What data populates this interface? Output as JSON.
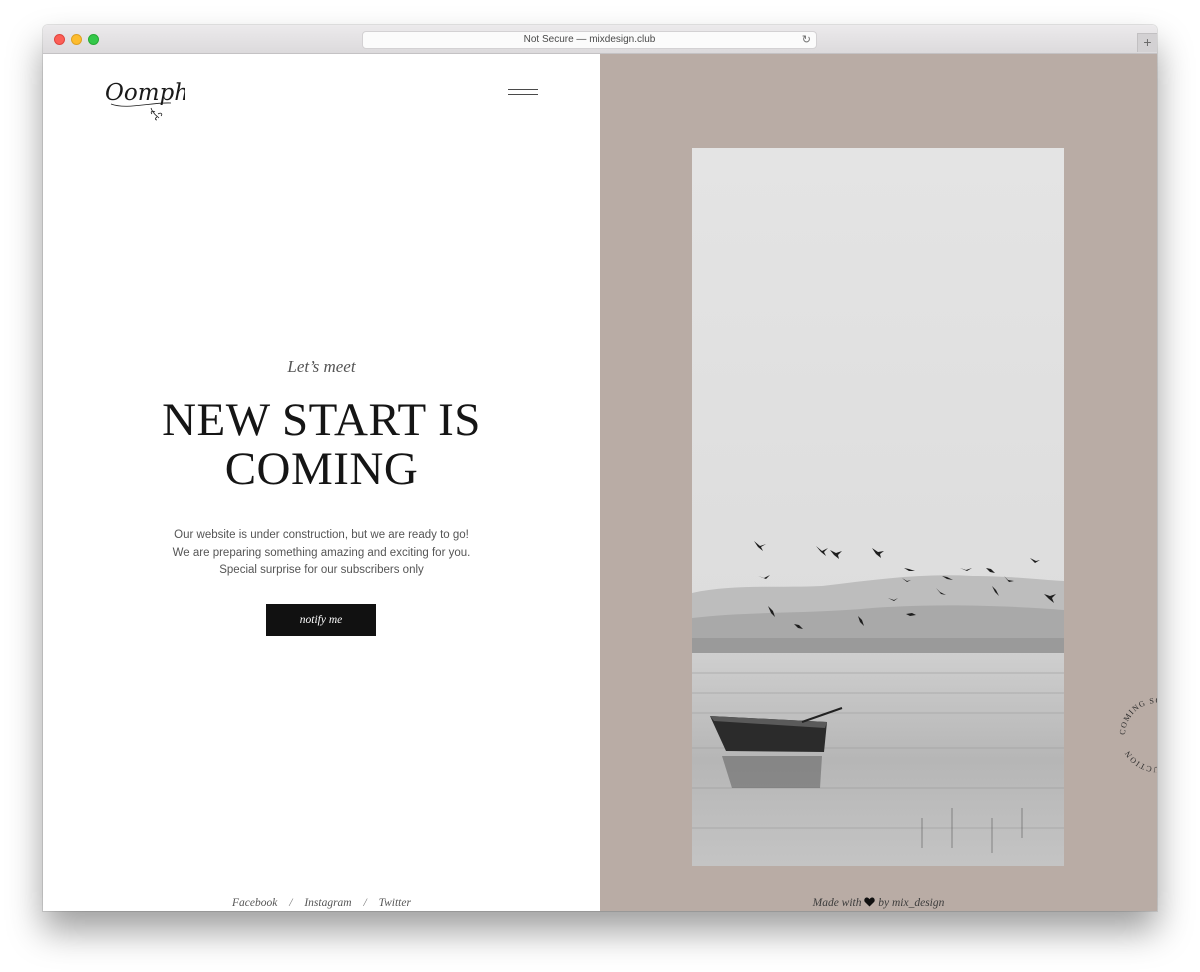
{
  "browser": {
    "url_text": "Not Secure — mixdesign.club",
    "new_tab_label": "+",
    "reload_label": "↻"
  },
  "brand": {
    "logo_text": "Oomph"
  },
  "hero": {
    "eyebrow": "Let’s meet",
    "headline_line1": "NEW START IS",
    "headline_line2": "COMING",
    "body_line1": "Our website is under construction, but we are ready to go!",
    "body_line2": "We are preparing something amazing and exciting for you.",
    "body_line3": "Special surprise for our subscribers only",
    "cta_label": "notify me"
  },
  "social": {
    "items": [
      {
        "label": "Facebook"
      },
      {
        "label": "Instagram"
      },
      {
        "label": "Twitter"
      }
    ],
    "separator": "/"
  },
  "badge": {
    "circular_text": "COMING SOON UNDER CONSTRUCTION"
  },
  "footer": {
    "made_with": "Made with",
    "by_text": "by mix_design"
  },
  "colors": {
    "right_panel_bg": "#b9aca5",
    "button_bg": "#111111",
    "heading_text": "#151515"
  },
  "icons": [
    "hamburger-menu-icon",
    "heart-icon",
    "reload-icon"
  ]
}
